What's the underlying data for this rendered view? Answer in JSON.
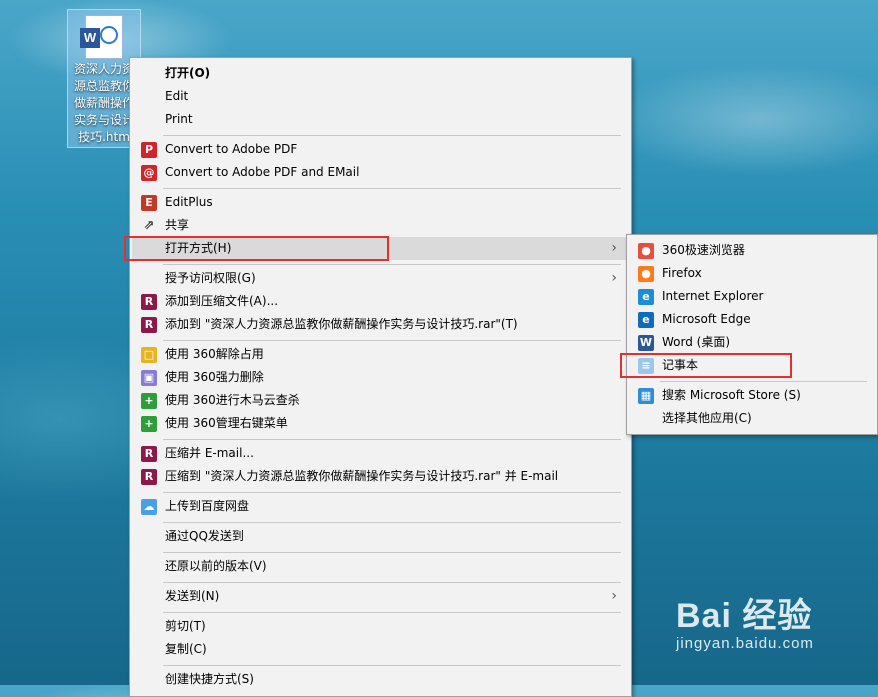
{
  "desktop_file": {
    "label": "资深人力资源总监教你做薪酬操作实务与设计技巧.htm"
  },
  "context_menu": {
    "groups": [
      [
        {
          "label": "打开(O)",
          "bold": true
        },
        {
          "label": "Edit"
        },
        {
          "label": "Print"
        }
      ],
      [
        {
          "label": "Convert to Adobe PDF",
          "icon": "adobe-pdf-icon"
        },
        {
          "label": "Convert to Adobe PDF and EMail",
          "icon": "adobe-pdf-email-icon"
        }
      ],
      [
        {
          "label": "EditPlus",
          "icon": "editplus-icon"
        },
        {
          "label": "共享",
          "icon": "share-icon"
        },
        {
          "label": "打开方式(H)",
          "submenu": true,
          "highlighted": true
        }
      ],
      [
        {
          "label": "授予访问权限(G)",
          "submenu": true
        },
        {
          "label": "添加到压缩文件(A)...",
          "icon": "winrar-icon"
        },
        {
          "label": "添加到 \"资深人力资源总监教你做薪酬操作实务与设计技巧.rar\"(T)",
          "icon": "winrar-icon"
        }
      ],
      [
        {
          "label": "使用 360解除占用",
          "icon": "360-unlock-icon"
        },
        {
          "label": "使用 360强力删除",
          "icon": "360-delete-icon"
        },
        {
          "label": "使用 360进行木马云查杀",
          "icon": "360-scan-icon"
        },
        {
          "label": "使用 360管理右键菜单",
          "icon": "360-menu-icon"
        }
      ],
      [
        {
          "label": "压缩并 E-mail...",
          "icon": "winrar-icon"
        },
        {
          "label": "压缩到 \"资深人力资源总监教你做薪酬操作实务与设计技巧.rar\" 并 E-mail",
          "icon": "winrar-icon"
        }
      ],
      [
        {
          "label": "上传到百度网盘",
          "icon": "baidu-netdisk-icon"
        }
      ],
      [
        {
          "label": "通过QQ发送到"
        }
      ],
      [
        {
          "label": "还原以前的版本(V)"
        }
      ],
      [
        {
          "label": "发送到(N)",
          "submenu": true
        }
      ],
      [
        {
          "label": "剪切(T)"
        },
        {
          "label": "复制(C)"
        }
      ],
      [
        {
          "label": "创建快捷方式(S)"
        }
      ]
    ]
  },
  "open_with_submenu": {
    "groups": [
      [
        {
          "label": "360极速浏览器",
          "icon": "360-browser-icon"
        },
        {
          "label": "Firefox",
          "icon": "firefox-icon"
        },
        {
          "label": "Internet Explorer",
          "icon": "internet-explorer-icon"
        },
        {
          "label": "Microsoft Edge",
          "icon": "edge-icon"
        },
        {
          "label": "Word (桌面)",
          "icon": "word-icon"
        },
        {
          "label": "记事本",
          "icon": "notepad-icon",
          "outlined": true
        }
      ],
      [
        {
          "label": "搜索 Microsoft Store (S)",
          "icon": "store-icon"
        },
        {
          "label": "选择其他应用(C)"
        }
      ]
    ]
  },
  "watermark": {
    "brand": "Bai  经验",
    "url": "jingyan.baidu.com"
  },
  "colors": {
    "highlight_box": "#e03030",
    "menu_bg": "#f2f2f2",
    "hover_bg": "#dadada"
  }
}
